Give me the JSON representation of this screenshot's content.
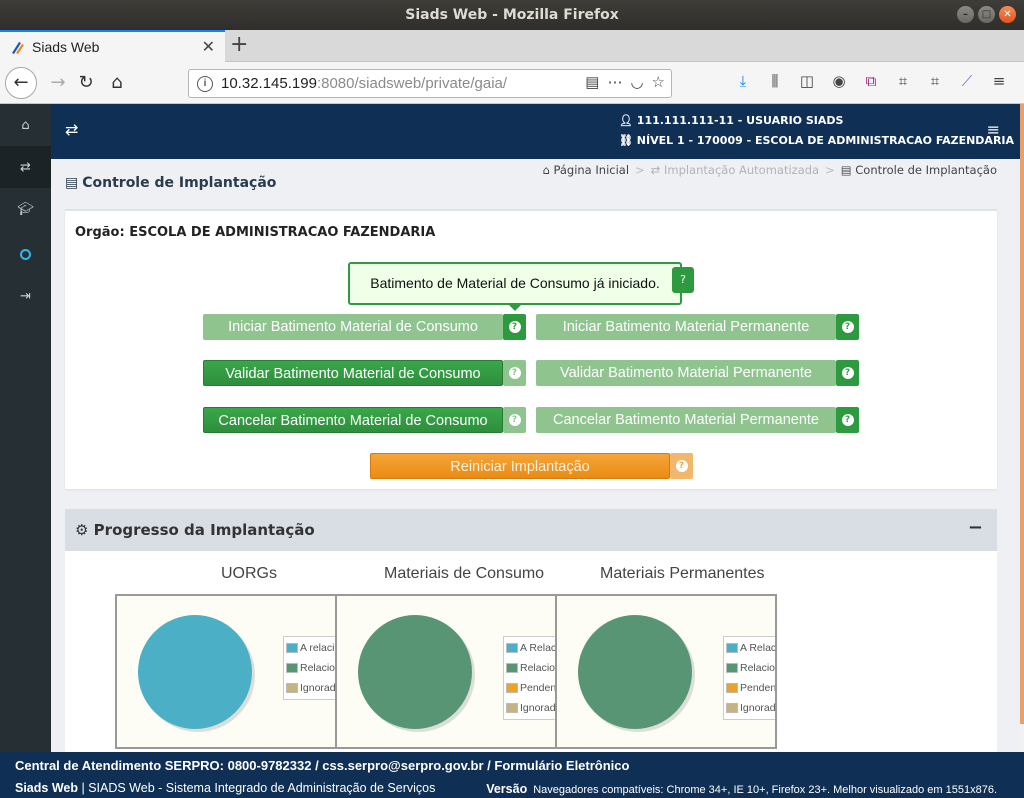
{
  "window": {
    "title": "Siads Web - Mozilla Firefox"
  },
  "browser": {
    "tab_title": "Siads Web",
    "url_host": "10.32.145.199",
    "url_rest": ":8080/siadsweb/private/gaia/",
    "toolbar_icons": [
      "download-icon",
      "library-icon",
      "sidebar-icon",
      "account-icon",
      "extension-icon",
      "crop-icon",
      "crop-icon",
      "feather-icon",
      "menu-icon"
    ]
  },
  "header": {
    "user": "111.111.111-11 - USUARIO SIADS",
    "org": "NÍVEL 1 - 170009 - ESCOLA DE ADMINISTRACAO FAZENDARIA"
  },
  "sidebar": {
    "items": [
      "home-icon",
      "exchange-icon",
      "graduation-icon",
      "ring-icon",
      "sign-in-icon"
    ]
  },
  "page": {
    "title": "Controle de Implantação",
    "breadcrumb": [
      "Página Inicial",
      "Implantação Automatizada",
      "Controle de Implantação"
    ]
  },
  "org_panel": {
    "label": "Orgão: ESCOLA DE ADMINISTRACAO FAZENDARIA",
    "tooltip": "Batimento de Material de Consumo já iniciado.",
    "buttons": {
      "iniciar_consumo": "Iniciar Batimento Material de Consumo",
      "iniciar_permanente": "Iniciar Batimento Material Permanente",
      "validar_consumo": "Validar Batimento Material de Consumo",
      "validar_permanente": "Validar Batimento Material Permanente",
      "cancelar_consumo": "Cancelar Batimento Material de Consumo",
      "cancelar_permanente": "Cancelar Batimento Material Permanente",
      "reiniciar": "Reiniciar Implantação"
    }
  },
  "progress": {
    "title": "Progresso da Implantação",
    "collapse_label": "−"
  },
  "colors": {
    "a_relacionar": "#4bafc6",
    "relacionados": "#579574",
    "pendentes": "#eaa228",
    "ignorados": "#c5b47f"
  },
  "chart_data": [
    {
      "type": "pie",
      "title": "UORGs",
      "legend": [
        "A relaci",
        "Relacio",
        "Ignorad"
      ],
      "values": [
        100,
        0,
        0
      ],
      "colors": [
        "#4bafc6",
        "#579574",
        "#c5b47f"
      ]
    },
    {
      "type": "pie",
      "title": "Materiais de Consumo",
      "legend": [
        "A Relac",
        "Relacio",
        "Penden",
        "Ignorad"
      ],
      "values": [
        0,
        100,
        0,
        0
      ],
      "colors": [
        "#4bafc6",
        "#579574",
        "#eaa228",
        "#c5b47f"
      ]
    },
    {
      "type": "pie",
      "title": "Materiais Permanentes",
      "legend": [
        "A Relacionar",
        "Relacionados",
        "Pendentes",
        "Ignorados"
      ],
      "values": [
        0,
        100,
        0,
        0
      ],
      "colors": [
        "#4bafc6",
        "#579574",
        "#eaa228",
        "#c5b47f"
      ]
    }
  ],
  "footer": {
    "line1": "Central de Atendimento SERPRO: 0800-9782332 / css.serpro@serpro.gov.br / Formulário Eletrônico",
    "app_name": "Siads Web",
    "app_desc": "| SIADS Web - Sistema Integrado de Administração de Serviços",
    "version_label": "Versão",
    "compat": "Navegadores compatíveis: Chrome 34+, IE 10+, Firefox 23+. Melhor visualizado em 1551x876."
  }
}
